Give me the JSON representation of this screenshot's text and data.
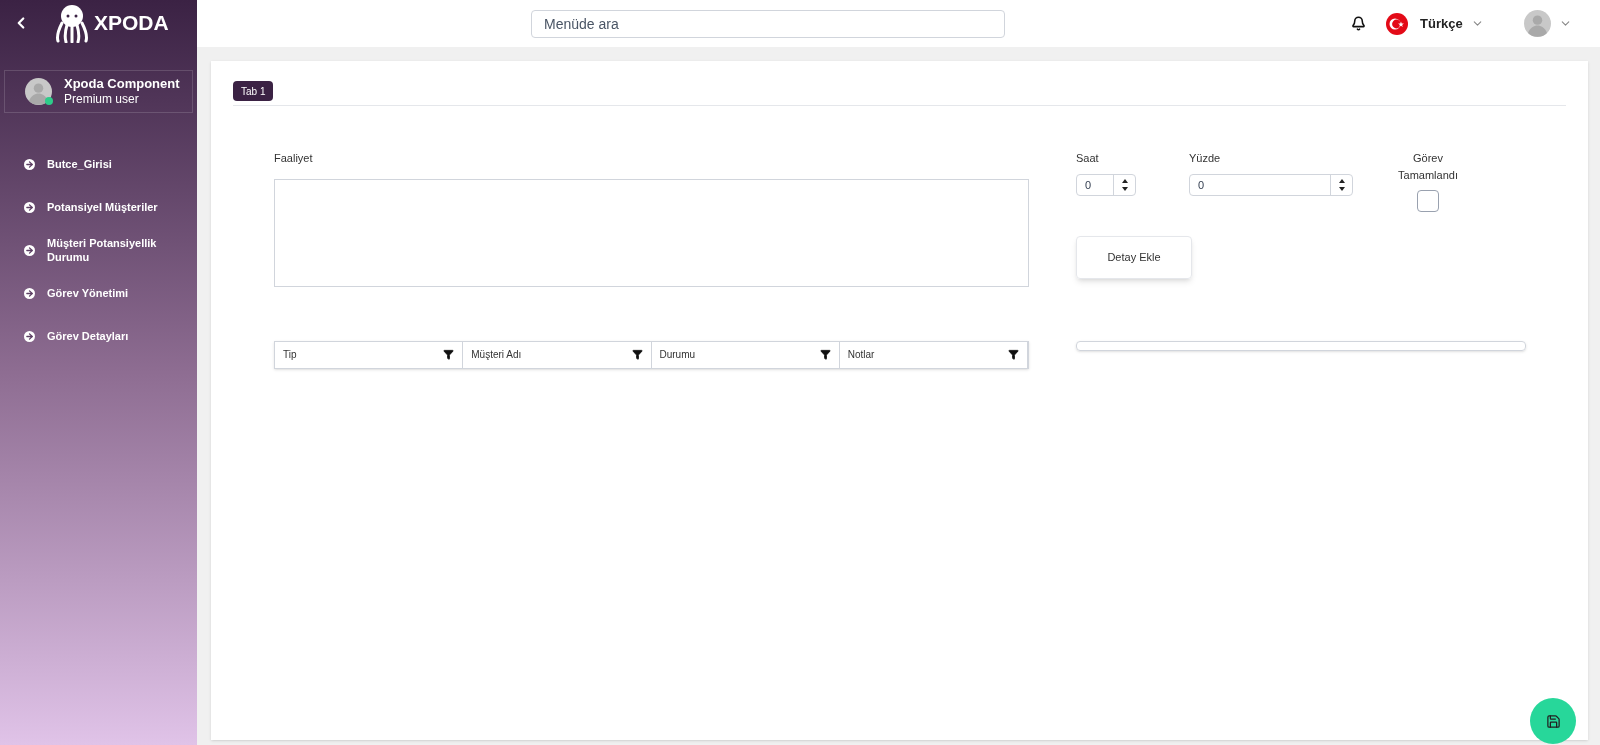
{
  "sidebar": {
    "logo": "XPODA",
    "user": {
      "name": "Xpoda Component",
      "role": "Premium user",
      "online": true
    },
    "items": [
      {
        "label": "Butce_Girisi"
      },
      {
        "label": "Potansiyel Müşteriler"
      },
      {
        "label": "Müşteri Potansiyellik Durumu"
      },
      {
        "label": "Görev Yönetimi"
      },
      {
        "label": "Görev Detayları"
      }
    ]
  },
  "topbar": {
    "search": {
      "placeholder": "Menüde ara"
    },
    "language": "Türkçe"
  },
  "tabs": [
    {
      "label": "Tab 1",
      "selected": true
    }
  ],
  "form": {
    "faaliyet": {
      "label": "Faaliyet"
    },
    "saat": {
      "label": "Saat",
      "value": "0"
    },
    "yuzde": {
      "label": "Yüzde",
      "value": "0"
    },
    "gorev_tamamlandi": {
      "label": "Görev Tamamlandı",
      "checked": false
    },
    "add_button": "Detay Ekle"
  },
  "grid": {
    "columns": [
      "Tip",
      "Müşteri Adı",
      "Durumu",
      "Notlar"
    ]
  }
}
